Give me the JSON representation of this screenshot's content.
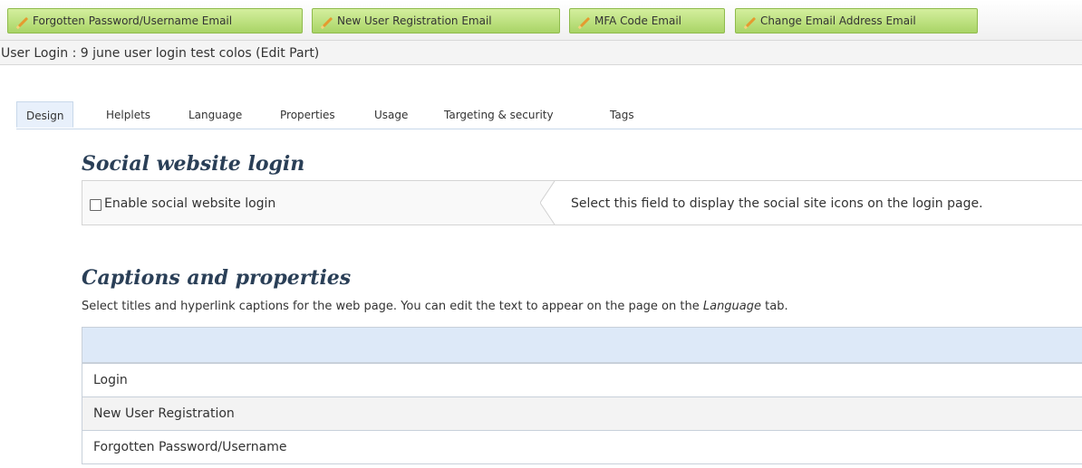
{
  "toolbar": {
    "buttons": [
      {
        "label": "Forgotten Password/Username Email",
        "icon": "pencil-icon"
      },
      {
        "label": "New User Registration Email",
        "icon": "pencil-icon"
      },
      {
        "label": "MFA Code Email",
        "icon": "pencil-icon"
      },
      {
        "label": "Change Email Address Email",
        "icon": "pencil-icon"
      }
    ]
  },
  "page": {
    "title": "User Login : 9 june user login test colos (Edit Part)"
  },
  "tabs": [
    {
      "label": "Design",
      "active": true
    },
    {
      "label": "Helplets",
      "active": false
    },
    {
      "label": "Language",
      "active": false
    },
    {
      "label": "Properties",
      "active": false
    },
    {
      "label": "Usage",
      "active": false
    },
    {
      "label": "Targeting & security",
      "active": false
    },
    {
      "label": "Tags",
      "active": false
    }
  ],
  "social": {
    "heading": "Social website login",
    "checkbox_label": "Enable social website login",
    "checked": false,
    "help_text": "Select this field to display the social site icons on the login page."
  },
  "captions": {
    "heading": "Captions and properties",
    "description_before": "Select titles and hyperlink captions for the web page. You can edit the text to appear on the page on the ",
    "description_em": "Language",
    "description_after": " tab.",
    "rows": [
      "Login",
      "New User Registration",
      "Forgotten Password/Username"
    ]
  },
  "colors": {
    "button_green": "#a9d466",
    "heading": "#2a3f57",
    "grid_header": "#dde9f8"
  }
}
